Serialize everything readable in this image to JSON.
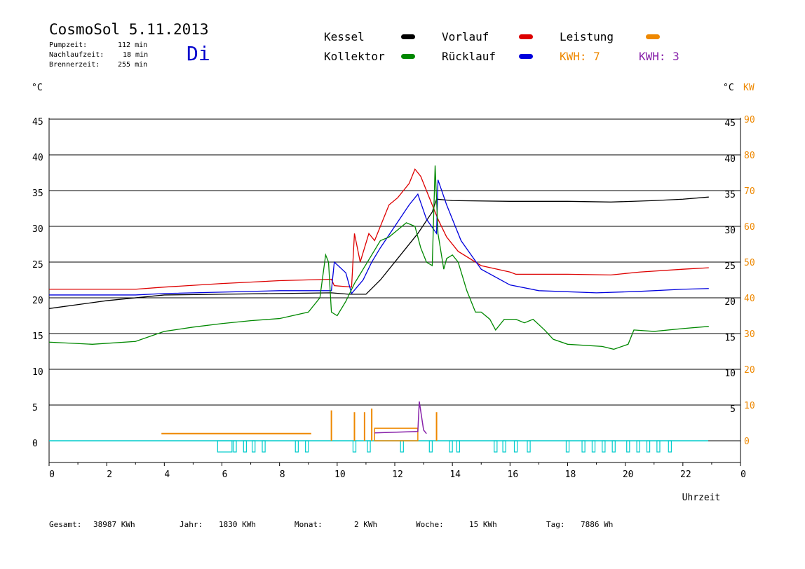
{
  "header": {
    "title": "CosmoSol 5.11.2013",
    "weekday": "Di",
    "stats": [
      {
        "label": "Pumpzeit:",
        "value": "112 min"
      },
      {
        "label": "Nachlaufzeit:",
        "value": "18 min"
      },
      {
        "label": "Brennerzeit:",
        "value": "255 min"
      }
    ]
  },
  "legend": {
    "kessel": {
      "label": "Kessel",
      "color": "#000000"
    },
    "vorlauf": {
      "label": "Vorlauf",
      "color": "#dd0000"
    },
    "leistung": {
      "label": "Leistung",
      "color": "#ee8800"
    },
    "kollektor": {
      "label": "Kollektor",
      "color": "#008800"
    },
    "ruecklauf": {
      "label": "Rücklauf",
      "color": "#0000dd"
    },
    "kwh1": "KWH: 7",
    "kwh2": "KWH: 3"
  },
  "units": {
    "left": "°C",
    "right_c": "°C",
    "right_kw": "KW"
  },
  "footer": {
    "gesamt": {
      "label": "Gesamt:",
      "value": "38987 KWh"
    },
    "jahr": {
      "label": "Jahr:",
      "value": "1830 KWh"
    },
    "monat": {
      "label": "Monat:",
      "value": "2 KWh"
    },
    "woche": {
      "label": "Woche:",
      "value": "15 KWh"
    },
    "tag": {
      "label": "Tag:",
      "value": "7886 Wh"
    }
  },
  "chart_data": {
    "type": "line",
    "xlabel": "Uhrzeit",
    "xlim": [
      0,
      24
    ],
    "x_ticks": [
      "0",
      "2",
      "4",
      "6",
      "8",
      "10",
      "12",
      "14",
      "16",
      "18",
      "20",
      "22",
      "0"
    ],
    "ylim": [
      0,
      45
    ],
    "y_left_ticks": [
      "0",
      "5",
      "10",
      "15",
      "20",
      "25",
      "30",
      "35",
      "40",
      "45"
    ],
    "y_right_ticks": [
      "5",
      "10",
      "15",
      "20",
      "25",
      "30",
      "35",
      "40",
      "45"
    ],
    "y2lim": [
      0,
      90
    ],
    "y2_ticks": [
      "0",
      "10",
      "20",
      "30",
      "40",
      "50",
      "60",
      "70",
      "80",
      "90"
    ],
    "grid": true,
    "series": [
      {
        "name": "Kessel",
        "color": "#000000",
        "points": [
          [
            0,
            18.5
          ],
          [
            2,
            19.6
          ],
          [
            4,
            20.4
          ],
          [
            6,
            20.5
          ],
          [
            8,
            20.6
          ],
          [
            9.8,
            20.7
          ],
          [
            10.4,
            20.5
          ],
          [
            11,
            20.5
          ],
          [
            11.5,
            22.5
          ],
          [
            12.2,
            26
          ],
          [
            12.8,
            29
          ],
          [
            13.3,
            32
          ],
          [
            13.45,
            33.8
          ],
          [
            14,
            33.6
          ],
          [
            16,
            33.5
          ],
          [
            18,
            33.5
          ],
          [
            19.5,
            33.4
          ],
          [
            21,
            33.6
          ],
          [
            22,
            33.8
          ],
          [
            22.9,
            34.1
          ]
        ]
      },
      {
        "name": "Vorlauf",
        "color": "#dd0000",
        "points": [
          [
            0,
            21.2
          ],
          [
            3,
            21.2
          ],
          [
            4,
            21.5
          ],
          [
            6,
            22
          ],
          [
            8,
            22.4
          ],
          [
            9.8,
            22.6
          ],
          [
            9.9,
            21.7
          ],
          [
            10.5,
            21.5
          ],
          [
            10.6,
            29
          ],
          [
            10.8,
            25
          ],
          [
            11.1,
            29
          ],
          [
            11.3,
            28
          ],
          [
            11.5,
            30
          ],
          [
            11.8,
            33
          ],
          [
            12.1,
            34
          ],
          [
            12.3,
            35
          ],
          [
            12.5,
            36
          ],
          [
            12.7,
            38
          ],
          [
            12.9,
            37
          ],
          [
            13.2,
            34
          ],
          [
            13.5,
            31
          ],
          [
            13.8,
            28.5
          ],
          [
            14.2,
            26.5
          ],
          [
            15,
            24.5
          ],
          [
            16,
            23.6
          ],
          [
            16.2,
            23.3
          ],
          [
            18,
            23.3
          ],
          [
            19.5,
            23.2
          ],
          [
            20.5,
            23.6
          ],
          [
            22,
            24
          ],
          [
            22.9,
            24.2
          ]
        ]
      },
      {
        "name": "Rücklauf",
        "color": "#0000dd",
        "points": [
          [
            0,
            20.4
          ],
          [
            3,
            20.4
          ],
          [
            4,
            20.6
          ],
          [
            6,
            20.8
          ],
          [
            8,
            21
          ],
          [
            9.8,
            21
          ],
          [
            9.9,
            25
          ],
          [
            10.3,
            23.5
          ],
          [
            10.5,
            20.6
          ],
          [
            10.9,
            22.5
          ],
          [
            11.2,
            25
          ],
          [
            11.5,
            27
          ],
          [
            12,
            30
          ],
          [
            12.5,
            33
          ],
          [
            12.8,
            34.5
          ],
          [
            13.1,
            31
          ],
          [
            13.45,
            29
          ],
          [
            13.5,
            36.5
          ],
          [
            13.8,
            33
          ],
          [
            14.3,
            28
          ],
          [
            15,
            24
          ],
          [
            16,
            21.8
          ],
          [
            17,
            21
          ],
          [
            19,
            20.7
          ],
          [
            20.5,
            20.9
          ],
          [
            22,
            21.2
          ],
          [
            22.9,
            21.3
          ]
        ]
      },
      {
        "name": "Kollektor",
        "color": "#008800",
        "points": [
          [
            0,
            13.8
          ],
          [
            1.5,
            13.5
          ],
          [
            3,
            13.9
          ],
          [
            4,
            15.3
          ],
          [
            5,
            15.9
          ],
          [
            6,
            16.4
          ],
          [
            7,
            16.8
          ],
          [
            8,
            17.1
          ],
          [
            9,
            18
          ],
          [
            9.4,
            20
          ],
          [
            9.6,
            26
          ],
          [
            9.7,
            25
          ],
          [
            9.8,
            18
          ],
          [
            10,
            17.5
          ],
          [
            10.3,
            19.5
          ],
          [
            10.6,
            22
          ],
          [
            10.9,
            24
          ],
          [
            11.2,
            26
          ],
          [
            11.5,
            28
          ],
          [
            11.8,
            28.5
          ],
          [
            12.1,
            29.5
          ],
          [
            12.4,
            30.5
          ],
          [
            12.7,
            30
          ],
          [
            12.9,
            27
          ],
          [
            13.1,
            25
          ],
          [
            13.3,
            24.5
          ],
          [
            13.4,
            38.5
          ],
          [
            13.5,
            29
          ],
          [
            13.7,
            24
          ],
          [
            13.8,
            25.5
          ],
          [
            14,
            26
          ],
          [
            14.2,
            25
          ],
          [
            14.5,
            21
          ],
          [
            14.8,
            18
          ],
          [
            15,
            18
          ],
          [
            15.3,
            17
          ],
          [
            15.5,
            15.5
          ],
          [
            15.8,
            17
          ],
          [
            16.2,
            17
          ],
          [
            16.5,
            16.5
          ],
          [
            16.8,
            17
          ],
          [
            17.2,
            15.5
          ],
          [
            17.5,
            14.2
          ],
          [
            18,
            13.5
          ],
          [
            19.2,
            13.2
          ],
          [
            19.6,
            12.8
          ],
          [
            20.1,
            13.5
          ],
          [
            20.3,
            15.5
          ],
          [
            21,
            15.3
          ],
          [
            22,
            15.7
          ],
          [
            22.9,
            16
          ]
        ]
      }
    ],
    "bars": {
      "name": "Leistung",
      "color": "#ee8800",
      "baseline_kw": 2,
      "baseline_range": [
        3.9,
        9.1
      ],
      "spikes": [
        {
          "t": 9.8,
          "kw": 8.5
        },
        {
          "t": 10.6,
          "kw": 8
        },
        {
          "t": 10.95,
          "kw": 8
        },
        {
          "t": 11.2,
          "kw": 9
        }
      ],
      "block_range": [
        11.3,
        12.8
      ],
      "block_kw": 3.5,
      "spike_late": {
        "t": 13.45,
        "kw": 8
      }
    },
    "purple_series": {
      "color": "#8822aa",
      "points": [
        [
          11.3,
          2.2
        ],
        [
          12.8,
          2.6
        ],
        [
          12.85,
          11
        ],
        [
          13.0,
          3
        ],
        [
          13.1,
          2
        ]
      ]
    },
    "pump_intervals": [
      [
        5.85,
        6.35
      ],
      [
        6.4,
        6.5
      ],
      [
        6.75,
        6.85
      ],
      [
        7.05,
        7.15
      ],
      [
        7.4,
        7.5
      ],
      [
        8.55,
        8.65
      ],
      [
        8.9,
        9
      ],
      [
        10.55,
        10.65
      ],
      [
        11.05,
        11.15
      ],
      [
        12.2,
        12.3
      ],
      [
        13.2,
        13.3
      ],
      [
        13.9,
        14
      ],
      [
        14.15,
        14.25
      ],
      [
        15.45,
        15.55
      ],
      [
        15.75,
        15.85
      ],
      [
        16.15,
        16.25
      ],
      [
        16.6,
        16.7
      ],
      [
        17.95,
        18.05
      ],
      [
        18.5,
        18.6
      ],
      [
        18.85,
        18.95
      ],
      [
        19.2,
        19.3
      ],
      [
        19.55,
        19.65
      ],
      [
        20.05,
        20.15
      ],
      [
        20.4,
        20.5
      ],
      [
        20.75,
        20.85
      ],
      [
        21.1,
        21.2
      ],
      [
        21.5,
        21.6
      ]
    ],
    "pump_color": "#00cccc"
  }
}
